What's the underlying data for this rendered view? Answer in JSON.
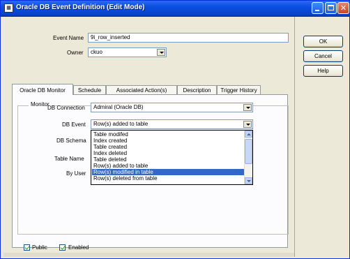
{
  "window": {
    "title": "Oracle DB Event Definition (Edit Mode)",
    "icon": "app-icon"
  },
  "form": {
    "event_name_label": "Event Name",
    "event_name_value": "9i_row_inserted",
    "owner_label": "Owner",
    "owner_value": "ckuo"
  },
  "tabs": [
    {
      "label": "Oracle DB Monitor",
      "active": true
    },
    {
      "label": "Schedule"
    },
    {
      "label": "Associated Action(s)"
    },
    {
      "label": "Description"
    },
    {
      "label": "Trigger History"
    }
  ],
  "monitor": {
    "group_label": "Monitor",
    "db_connection_label": "DB Connection",
    "db_connection_value": "Admiral (Oracle DB)",
    "db_event_label": "DB Event",
    "db_event_value": "Row(s) added to table",
    "db_schema_label": "DB Schema",
    "table_name_label": "Table Name",
    "by_user_label": "By User"
  },
  "dropdown": {
    "items": [
      "Table modifed",
      "Index created",
      "Table created",
      "Index deleted",
      "Table deleted",
      "Row(s) added to table",
      "Row(s) modified in table",
      "Row(s) deleted from table"
    ],
    "selected_index": 6
  },
  "checkboxes": {
    "public_label": "Public",
    "public_checked": true,
    "enabled_label": "Enabled",
    "enabled_checked": true
  },
  "buttons": {
    "ok": "OK",
    "cancel": "Cancel",
    "help": "Help"
  }
}
